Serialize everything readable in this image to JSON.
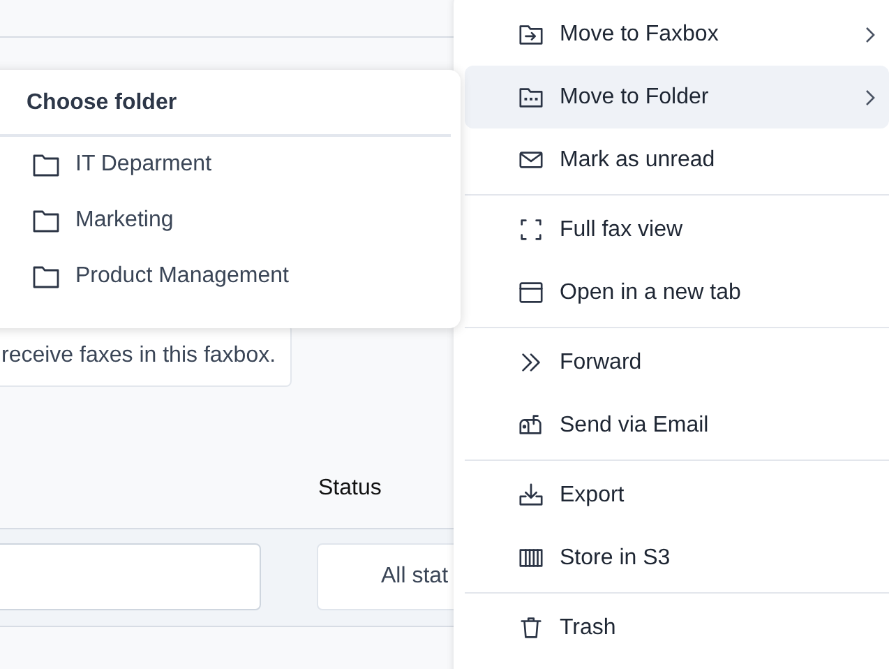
{
  "page": {
    "notice": "receive faxes in this faxbox.",
    "filters": [
      {
        "label": "Status",
        "value": "All stat"
      }
    ]
  },
  "folder_menu": {
    "title": "Choose folder",
    "items": [
      {
        "label": "IT Deparment"
      },
      {
        "label": "Marketing"
      },
      {
        "label": "Product Management"
      }
    ]
  },
  "context_menu": {
    "groups": [
      [
        {
          "label": "Move to Faxbox",
          "submenu": true,
          "selected": false
        },
        {
          "label": "Move to Folder",
          "submenu": true,
          "selected": true
        },
        {
          "label": "Mark as unread",
          "submenu": false,
          "selected": false
        }
      ],
      [
        {
          "label": "Full fax view",
          "submenu": false,
          "selected": false
        },
        {
          "label": "Open in a new tab",
          "submenu": false,
          "selected": false
        }
      ],
      [
        {
          "label": "Forward",
          "submenu": false,
          "selected": false
        },
        {
          "label": "Send via Email",
          "submenu": false,
          "selected": false
        }
      ],
      [
        {
          "label": "Export",
          "submenu": false,
          "selected": false
        },
        {
          "label": "Store in S3",
          "submenu": false,
          "selected": false
        }
      ],
      [
        {
          "label": "Trash",
          "submenu": false,
          "selected": false
        }
      ]
    ]
  }
}
